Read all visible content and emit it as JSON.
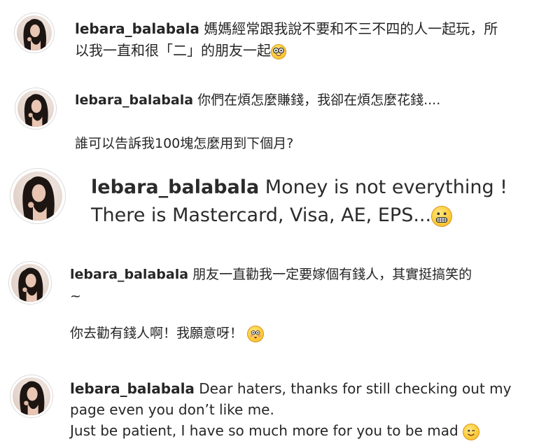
{
  "posts": [
    {
      "username": "lebara_balabala",
      "lines": [
        "媽媽經常跟我說不要和不三不四的人一起玩，所",
        "以我一直和很「二」的朋友一起"
      ],
      "emoji": "nerd-face-emoji"
    },
    {
      "username": "lebara_balabala",
      "lines": [
        "你們在煩怎麼賺錢，我卻在煩怎麼花錢....",
        "誰可以告訴我100塊怎麼用到下個月?"
      ]
    },
    {
      "username": "lebara_balabala",
      "lines": [
        "Money is not everything !",
        "There is Mastercard, Visa, AE, EPS..."
      ],
      "emoji": "grimacing-face-emoji"
    },
    {
      "username": "lebara_balabala",
      "lines": [
        "朋友一直勸我一定要嫁個有錢人，其實挺搞笑的",
        "~",
        "你去勸有錢人啊！我願意呀！"
      ],
      "emoji": "flushed-face-emoji"
    },
    {
      "username": "lebara_balabala",
      "lines": [
        "Dear haters, thanks for still checking out my",
        "page even you don’t like me.",
        "Just be patient, I have so much more for you to be mad"
      ],
      "emoji": "winking-face-emoji"
    }
  ]
}
